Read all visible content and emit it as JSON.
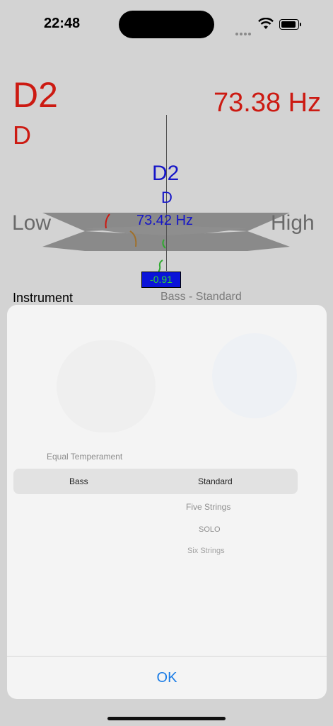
{
  "status": {
    "time": "22:48"
  },
  "tuner": {
    "detected_note": "D2",
    "detected_letter": "D",
    "detected_frequency": "73.38 Hz",
    "target_note": "D2",
    "target_letter": "D",
    "target_frequency": "73.42 Hz",
    "low_label": "Low",
    "high_label": "High",
    "cents_offset": "-0.91"
  },
  "instrument": {
    "label": "Instrument",
    "value": "Bass - Standard"
  },
  "picker": {
    "temperament": "Equal Temperament",
    "selected_instrument": "Bass",
    "selected_tuning": "Standard",
    "options": [
      "Five Strings",
      "SOLO",
      "Six Strings"
    ],
    "ok_label": "OK"
  },
  "colors": {
    "detected": "#cc1a12",
    "target": "#1616c8",
    "accent": "#1a7ce6",
    "cents_bg": "#0a14d8",
    "cents_text": "#2fd92f"
  },
  "icons": [
    "wifi-icon",
    "battery-icon",
    "cellular-dots-icon"
  ]
}
